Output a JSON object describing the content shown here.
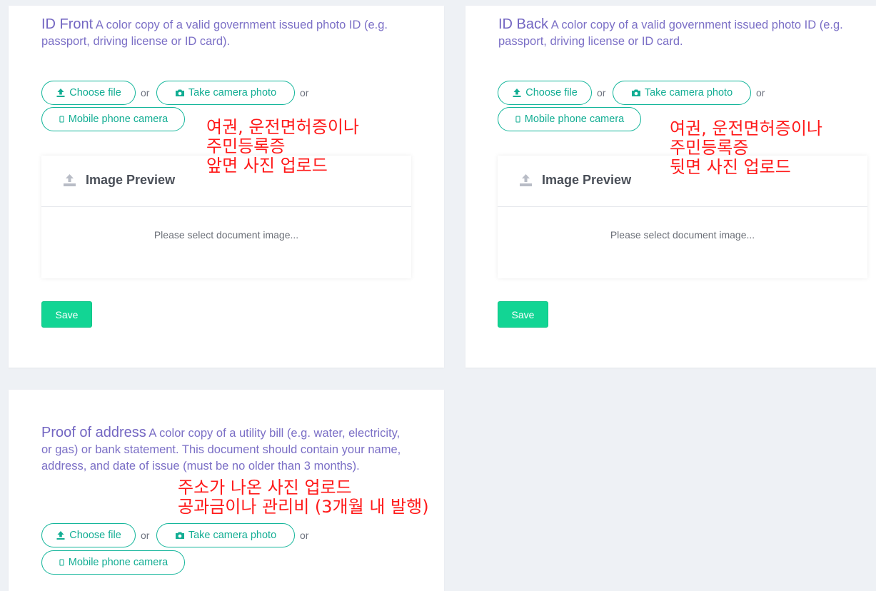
{
  "front": {
    "title": "ID Front",
    "description": " A color copy of a valid government issued photo ID (e.g. passport, driving license or ID card).",
    "choose_file": "Choose file",
    "or1": "or",
    "take_photo": "Take camera photo",
    "or2": "or",
    "mobile_camera": "Mobile phone camera",
    "preview_title": "Image Preview",
    "preview_msg": "Please select document image...",
    "save": "Save",
    "note": "여권, 운전면허증이나\n주민등록증\n앞면 사진 업로드"
  },
  "back": {
    "title": "ID Back",
    "description": " A color copy of a valid government issued photo ID (e.g. passport, driving license or ID card.",
    "choose_file": "Choose file",
    "or1": "or",
    "take_photo": "Take camera photo",
    "or2": "or",
    "mobile_camera": "Mobile phone camera",
    "preview_title": "Image Preview",
    "preview_msg": "Please select document image...",
    "save": "Save",
    "note": "여권, 운전면허증이나\n주민등록증\n뒷면 사진 업로드"
  },
  "address": {
    "title": "Proof of address",
    "description": " A color copy of a utility bill (e.g. water, electricity, or gas) or bank statement. This document should contain your name, address, and date of issue (must be no older than 3 months).",
    "choose_file": "Choose file",
    "or1": "or",
    "take_photo": "Take camera photo",
    "or2": "or",
    "mobile_camera": "Mobile phone camera",
    "note": "주소가 나온 사진 업로드\n공과금이나 관리비 (3개월 내 발행)"
  },
  "colors": {
    "accent": "#12ad93",
    "title_purple": "#7366c2",
    "save_green": "#12d594",
    "annotation_red": "#ff1a1a"
  },
  "icons": {
    "choose_file": "upload-icon",
    "take_photo": "camera-icon",
    "mobile_camera": "mobile-icon",
    "preview": "upload-tray-icon"
  }
}
